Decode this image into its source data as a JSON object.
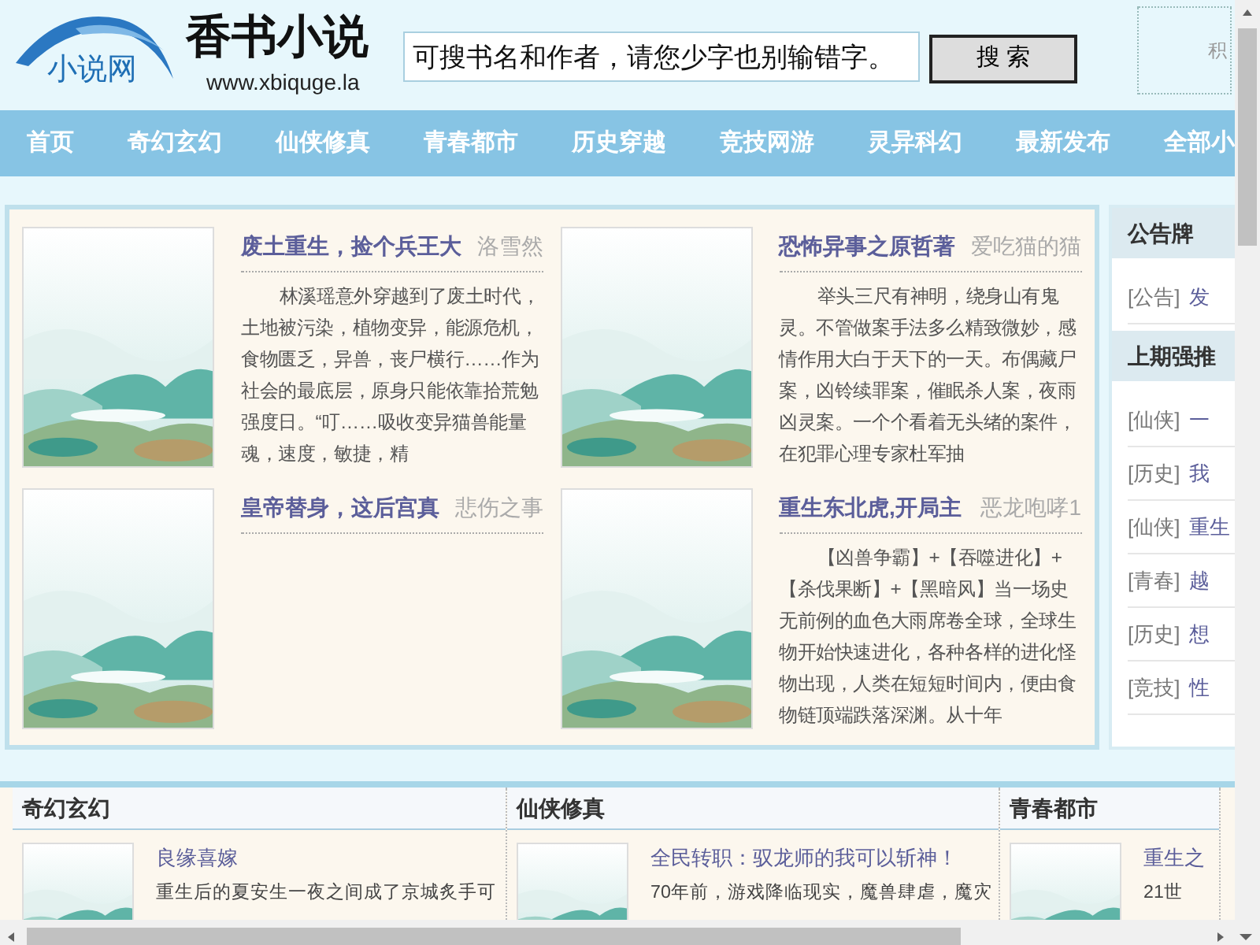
{
  "header": {
    "logo_text": "小说网",
    "site_title": "香书小说",
    "site_url": "www.xbiquge.la",
    "search": {
      "value": "可搜书名和作者，请您少字也别输错字。"
    },
    "search_button": "搜 索",
    "user_box_text": "积"
  },
  "nav": [
    {
      "label": "首页"
    },
    {
      "label": "奇幻玄幻"
    },
    {
      "label": "仙侠修真"
    },
    {
      "label": "青春都市"
    },
    {
      "label": "历史穿越"
    },
    {
      "label": "竞技网游"
    },
    {
      "label": "灵异科幻"
    },
    {
      "label": "最新发布"
    },
    {
      "label": "全部小"
    }
  ],
  "featured": [
    {
      "title": "废土重生，捡个兵王大",
      "author": "洛雪然",
      "description": "林溪瑶意外穿越到了废土时代，土地被污染，植物变异，能源危机，食物匮乏，异兽，丧尸横行……作为社会的最底层，原身只能依靠拾荒勉强度日。“叮……吸收变异猫兽能量魂，速度，敏捷，精"
    },
    {
      "title": "恐怖异事之原哲著",
      "author": "爱吃猫的猫",
      "description": "举头三尺有神明，绕身山有鬼灵。不管做案手法多么精致微妙，感情作用大白于天下的一天。布偶藏尸案，凶铃续罪案，催眠杀人案，夜雨凶灵案。一个个看着无头绪的案件，在犯罪心理专家杜军抽"
    },
    {
      "title": "皇帝替身，这后宫真",
      "author": "悲伤之事"
    },
    {
      "title": "重生东北虎,开局主",
      "author": "恶龙咆哮1",
      "description": "【凶兽争霸】+【吞噬进化】+【杀伐果断】+【黑暗风】当一场史无前例的血色大雨席卷全球，全球生物开始快速进化，各种各样的进化怪物出现，人类在短短时间内，便由食物链顶端跌落深渊。从十年"
    }
  ],
  "sidebar": [
    {
      "heading": "公告牌",
      "items": [
        {
          "tag": "[公告]",
          "title": "发"
        }
      ]
    },
    {
      "heading": "上期强推",
      "items": [
        {
          "tag": "[仙侠]",
          "title": "一"
        },
        {
          "tag": "[历史]",
          "title": "我"
        },
        {
          "tag": "[仙侠]",
          "title": "重生"
        },
        {
          "tag": "[青春]",
          "title": "越"
        },
        {
          "tag": "[历史]",
          "title": "想"
        },
        {
          "tag": "[竞技]",
          "title": "性"
        }
      ]
    }
  ],
  "categories": [
    {
      "heading": "奇幻玄幻",
      "books": [
        {
          "title": "良缘喜嫁",
          "description": "重生后的夏安生一夜之间成了京城炙手可"
        }
      ]
    },
    {
      "heading": "仙侠修真",
      "books": [
        {
          "title": "全民转职：驭龙师的我可以斩神！",
          "description": "70年前，游戏降临现实，魔兽肆虐，魔灾"
        }
      ]
    },
    {
      "heading": "青春都市",
      "books": [
        {
          "title": "重生之",
          "description": "21世"
        }
      ]
    }
  ]
}
